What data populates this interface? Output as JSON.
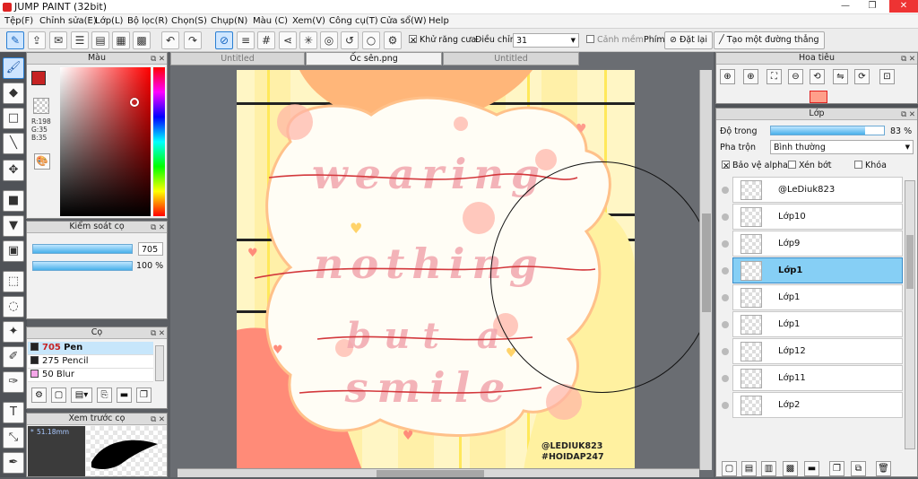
{
  "window": {
    "title": "JUMP PAINT (32bit)"
  },
  "menu": [
    "Tệp(F)",
    "Chỉnh sửa(E)",
    "Lớp(L)",
    "Bộ lọc(R)",
    "Chọn(S)",
    "Chụp(N)",
    "Màu (C)",
    "Xem(V)",
    "Công cụ(T)",
    "Cửa sổ(W)",
    "Help"
  ],
  "toolbar": {
    "antialias_label": "Khử răng cưa",
    "adjust_label": "Điều chỉnh",
    "adjust_value": "31",
    "smooth_label": "Cảnh mềm",
    "key_label": "Phím",
    "reset_label": "Đặt lại",
    "straight_label": "Tạo một đường thẳng"
  },
  "color_panel": {
    "title": "Màu",
    "r": "R:198",
    "g": "G:35",
    "b": "B:35",
    "primary": "#c62323"
  },
  "brush_control": {
    "title": "Kiểm soát cọ",
    "size": "705",
    "opacity": "100 %"
  },
  "brush_panel": {
    "title": "Cọ",
    "items": [
      {
        "size": "705",
        "name": "Pen",
        "color": "#222222"
      },
      {
        "size": "275",
        "name": "Pencil",
        "color": "#222222"
      },
      {
        "size": "50",
        "name": "Blur",
        "color": "#f4a6e8"
      }
    ]
  },
  "preview_panel": {
    "title": "Xem trước cọ",
    "size": "51.18mm"
  },
  "tabs": [
    "Untitled",
    "Ốc sên.png",
    "Untitled"
  ],
  "canvas": {
    "lines": [
      "wearing",
      "nothing",
      "but a",
      "smile"
    ],
    "credit1": "@LEDIUK823",
    "credit2": "#HOIDAP247"
  },
  "navigator": {
    "title": "Hoa tiêu"
  },
  "layers": {
    "title": "Lớp",
    "opacity_label": "Độ trong",
    "opacity_value": "83 %",
    "opacity": 0.83,
    "blend_label": "Pha trộn",
    "blend_value": "Bình thường",
    "protect_alpha": "Bảo vệ alpha",
    "clip": "Xén bớt",
    "lock": "Khóa",
    "items": [
      "@LeDiuk823",
      "Lớp10",
      "Lớp9",
      "Lớp1",
      "Lớp1",
      "Lớp1",
      "Lớp12",
      "Lớp11",
      "Lớp2"
    ],
    "selected_index": 3
  }
}
